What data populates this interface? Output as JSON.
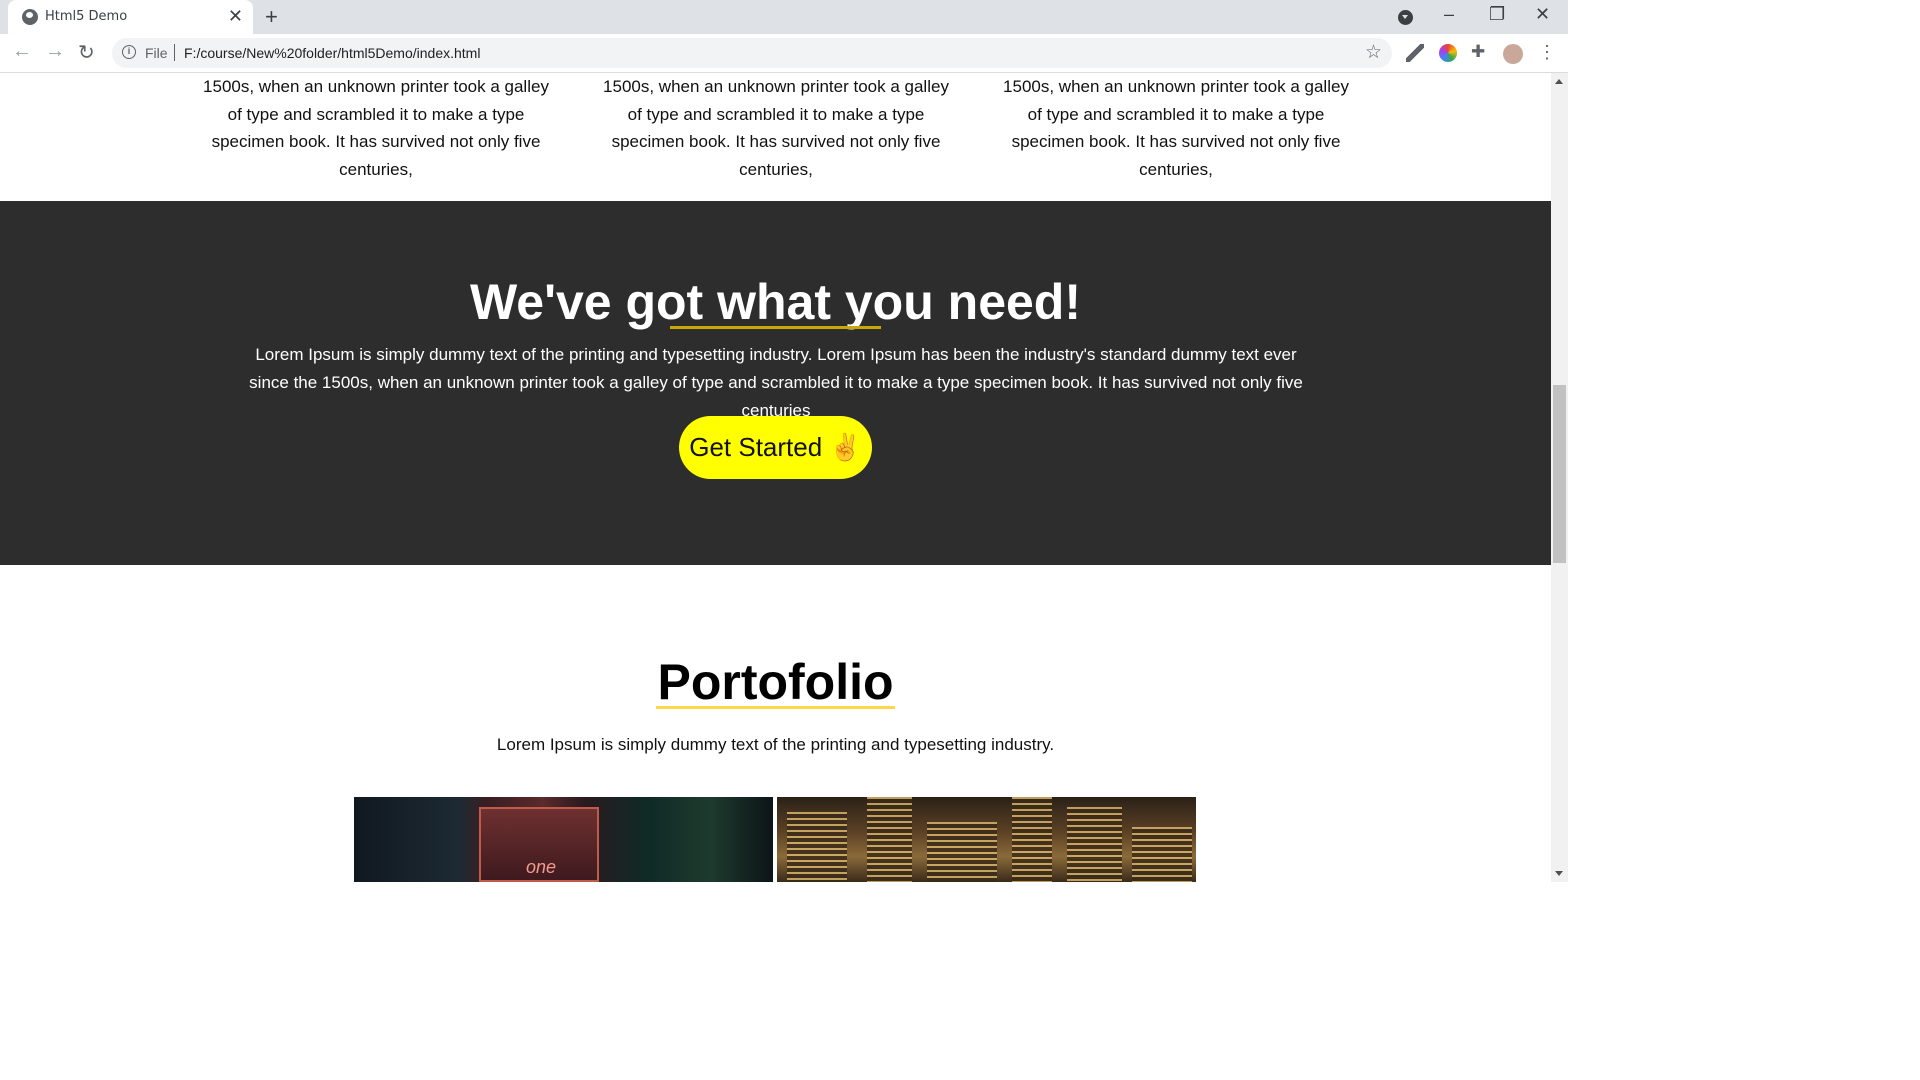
{
  "browser": {
    "tab_title": "Html5 Demo",
    "address_scheme": "File",
    "address_url": "F:/course/New%20folder/html5Demo/index.html"
  },
  "features": {
    "text": "1500s, when an unknown printer took a galley of type and scrambled it to make a type specimen book. It has survived not only five centuries,"
  },
  "cta": {
    "heading": "We've got what you need!",
    "body": "Lorem Ipsum is simply dummy text of the printing and typesetting industry. Lorem Ipsum has been the industry's standard dummy text ever since the 1500s, when an unknown printer took a galley of type and scrambled it to make a type specimen book. It has survived not only five centuries",
    "button_label": "Get Started ✌",
    "background": "#2d2d2d",
    "button_color": "#ffff00"
  },
  "portfolio": {
    "heading": "Portofolio",
    "subtitle": "Lorem Ipsum is simply dummy text of the printing and typesetting industry.",
    "image1_sign": "one",
    "underline_color": "#ffd54a"
  }
}
